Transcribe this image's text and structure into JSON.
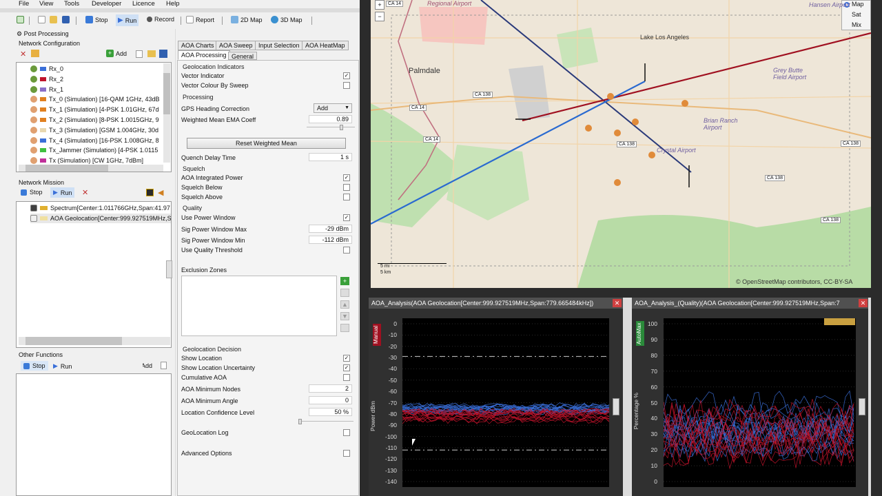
{
  "menu": [
    "File",
    "View",
    "Tools",
    "Developer",
    "Licence",
    "Help"
  ],
  "toolbar": {
    "stop": "Stop",
    "run": "Run",
    "record": "Record",
    "report": "Report",
    "map2d": "2D Map",
    "map3d": "3D Map"
  },
  "left": {
    "post_processing": "Post Processing",
    "network_configuration": "Network Configuration",
    "add": "Add",
    "nodes": [
      {
        "label": "Rx_0",
        "color": "#3a6fd8"
      },
      {
        "label": "Rx_2",
        "color": "#c0132a"
      },
      {
        "label": "Rx_1",
        "color": "#8a6fc8"
      },
      {
        "label": "Tx_0 (Simulation) [16-QAM 1GHz, 43dB",
        "color": "#e08020"
      },
      {
        "label": "Tx_1 (Simulation) [4-PSK 1.01GHz, 67d",
        "color": "#e08020"
      },
      {
        "label": "Tx_2 (Simulation) [8-PSK 1.0015GHz, 9",
        "color": "#e08020"
      },
      {
        "label": "Tx_3 (Simulation) [GSM 1.004GHz, 30d",
        "color": "#e8d8b0"
      },
      {
        "label": "Tx_4 (Simulation) [16-PSK 1.008GHz, 8",
        "color": "#3a6fd8"
      },
      {
        "label": "Tx_Jammer (Simulation) [4-PSK 1.0115",
        "color": "#40c040"
      },
      {
        "label": "Tx (Simulation) [CW 1GHz, 7dBm]",
        "color": "#c0309a"
      }
    ],
    "network_mission": "Network Mission",
    "stop": "Stop",
    "run": "Run",
    "missions": [
      {
        "label": "Spectrum[Center:1.011766GHz,Span:41.97",
        "color": "#e0b030"
      },
      {
        "label": "AOA Geolocation[Center:999.927519MHz,S",
        "color": "#f0e0a0"
      }
    ],
    "other_functions": "Other Functions",
    "other_stop": "Stop",
    "other_run": "Run",
    "other_add": "Add"
  },
  "tabs": {
    "row1": [
      "AOA Charts",
      "AOA Sweep",
      "Input Selection",
      "AOA HeatMap"
    ],
    "row2": [
      "AOA Processing",
      "General"
    ]
  },
  "settings": {
    "geo_indicators": "Geolocation Indicators",
    "vector_indicator": "Vector Indicator",
    "vector_colour": "Vector Colour By Sweep",
    "processing": "Processing",
    "gps_heading": "GPS Heading Correction",
    "gps_heading_value": "Add",
    "ema_coeff": "Weighted Mean EMA Coeff",
    "ema_value": "0.89",
    "reset_button": "Reset Weighted Mean",
    "quench": "Quench Delay Time",
    "quench_value": "1 s",
    "squelch": "Squelch",
    "aoa_integrated": "AOA Integrated Power",
    "squelch_below": "Squelch Below",
    "squelch_above": "Squelch Above",
    "quality": "Quality",
    "use_power_window": "Use Power Window",
    "sig_max": "Sig Power Window Max",
    "sig_max_value": "-29 dBm",
    "sig_min": "Sig Power Window Min",
    "sig_min_value": "-112 dBm",
    "use_quality": "Use Quality Threshold",
    "exclusion": "Exclusion Zones",
    "geo_decision": "Geolocation Decision",
    "show_location": "Show Location",
    "show_uncertainty": "Show Location Uncertainty",
    "cumulative": "Cumulative AOA",
    "min_nodes": "AOA Minimum Nodes",
    "min_nodes_value": "2",
    "min_angle": "AOA Minimum Angle",
    "min_angle_value": "0",
    "confidence": "Location Confidence Level",
    "confidence_value": "50 %",
    "geo_log": "GeoLocation Log",
    "advanced": "Advanced Options"
  },
  "map": {
    "labels": [
      "Regional Airport",
      "Lake Los Angeles",
      "Palmdale",
      "Grey Butte Field Airport",
      "Brian Ranch Airport",
      "Crystal Airport",
      "Hansen Airport"
    ],
    "roads": [
      "CA 14",
      "CA 138",
      "CA 138",
      "CA 138",
      "CA 138",
      "CA 14",
      "CA 14",
      "CA 138"
    ],
    "layers": [
      "Map",
      "Sat",
      "Mix"
    ],
    "scale_top": "5 mi",
    "scale_bottom": "5 km",
    "attribution": "© OpenStreetMap contributors, CC-BY-SA"
  },
  "chart1": {
    "title": "AOA_Analysis(AOA Geolocation[Center:999.927519MHz,Span:779.665484kHz])",
    "badge": "Manual",
    "ylabel": "Power dBm"
  },
  "chart2": {
    "title": "AOA_Analysis_(Quality)(AOA Geolocation[Center:999.927519MHz,Span:7",
    "badge": "AutoMax",
    "ylabel": "Percentage %"
  },
  "chart_data": [
    {
      "type": "line",
      "title": "AOA_Analysis(AOA Geolocation[Center:999.927519MHz,Span:779.665484kHz])",
      "ylabel": "Power dBm",
      "ylim": [
        -140,
        0
      ],
      "yticks": [
        0,
        -10,
        -20,
        -30,
        -40,
        -50,
        -60,
        -70,
        -80,
        -90,
        -100,
        -110,
        -120,
        -130,
        -140
      ],
      "series": [
        {
          "color": "#3a6fd8",
          "band": [
            -72,
            -80
          ]
        },
        {
          "color": "#c0132a",
          "band": [
            -78,
            -88
          ]
        }
      ],
      "thresholds": [
        -29,
        -112
      ]
    },
    {
      "type": "line",
      "title": "AOA_Analysis_(Quality)(AOA Geolocation[Center:999.927519MHz,Span:7",
      "ylabel": "Percentage %",
      "ylim": [
        0,
        100
      ],
      "yticks": [
        100,
        90,
        80,
        70,
        60,
        50,
        40,
        30,
        20,
        10,
        0
      ],
      "series": [
        {
          "color": "#3a6fd8",
          "band": [
            20,
            50
          ]
        },
        {
          "color": "#c0132a",
          "band": [
            15,
            45
          ]
        }
      ]
    }
  ]
}
